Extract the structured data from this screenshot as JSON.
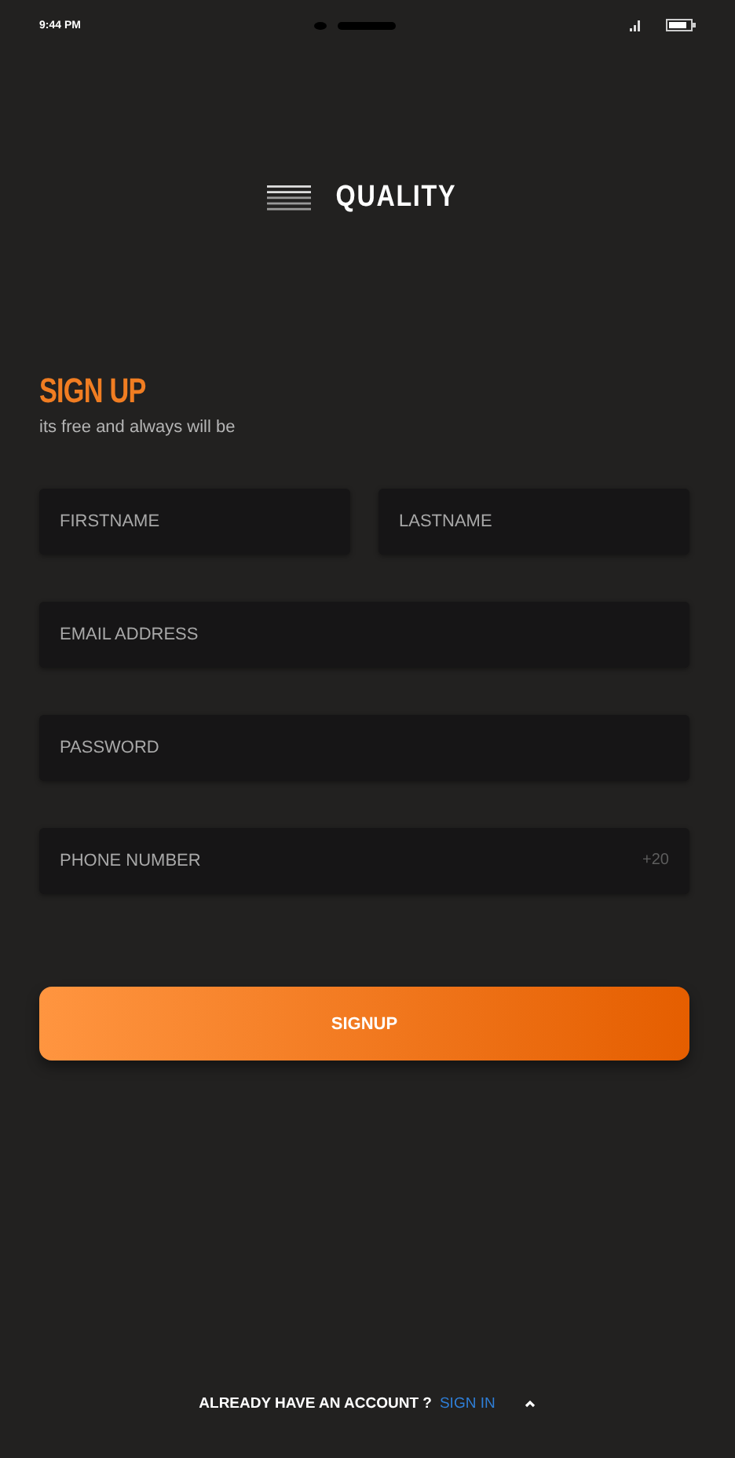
{
  "status_bar": {
    "time": "9:44 PM"
  },
  "logo": {
    "text": "QUALITY"
  },
  "heading": {
    "title": "SIGN UP",
    "subtitle": "its free and always will be"
  },
  "fields": [
    {
      "placeholder": "FIRSTNAME"
    },
    {
      "placeholder": "LASTNAME"
    },
    {
      "placeholder": "EMAIL ADDRESS"
    },
    {
      "placeholder": "PASSWORD"
    },
    {
      "placeholder": "PHONE NUMBER",
      "suffix": "+20"
    }
  ],
  "submit": {
    "label": "SIGNUP"
  },
  "footer": {
    "prompt": "ALREADY HAVE AN ACCOUNT ?",
    "link": "SIGN IN"
  }
}
